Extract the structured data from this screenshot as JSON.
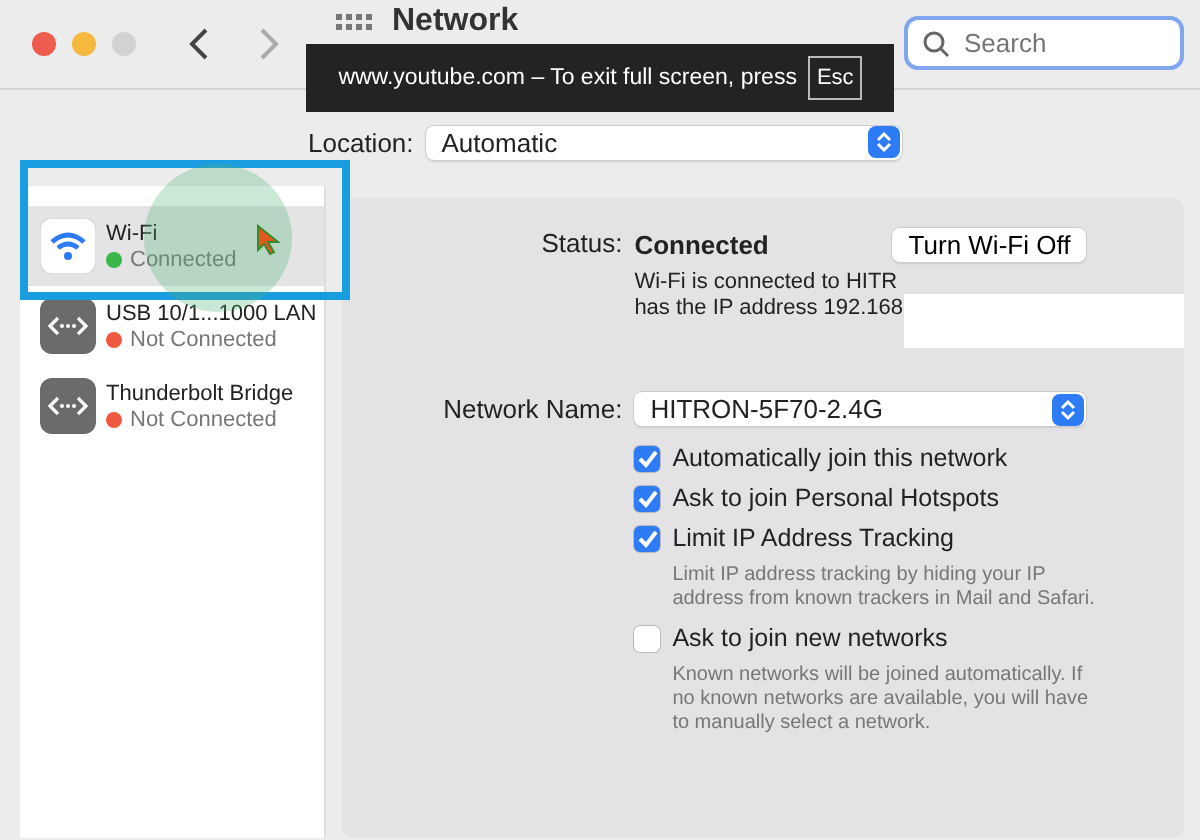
{
  "window": {
    "title": "Network",
    "banner": {
      "text": "www.youtube.com – To exit full screen, press",
      "key": "Esc"
    }
  },
  "search": {
    "placeholder": "Search"
  },
  "location": {
    "label": "Location:",
    "value": "Automatic"
  },
  "sidebar": {
    "items": [
      {
        "name": "Wi-Fi",
        "status": "Connected",
        "color": "#3cb54a",
        "kind": "wifi",
        "selected": true
      },
      {
        "name": "USB 10/1...1000 LAN",
        "status": "Not Connected",
        "color": "#f0583f",
        "kind": "ethernet",
        "selected": false
      },
      {
        "name": "Thunderbolt Bridge",
        "status": "Not Connected",
        "color": "#f0583f",
        "kind": "ethernet",
        "selected": false
      }
    ]
  },
  "status": {
    "label": "Status:",
    "value": "Connected",
    "button": "Turn Wi-Fi Off",
    "description": [
      "Wi-Fi is connected to HITR",
      "has the IP address 192.168"
    ]
  },
  "network_name": {
    "label": "Network Name:",
    "value": "HITRON-5F70-2.4G"
  },
  "options": [
    {
      "label": "Automatically join this network",
      "checked": true
    },
    {
      "label": "Ask to join Personal Hotspots",
      "checked": true
    },
    {
      "label": "Limit IP Address Tracking",
      "checked": true,
      "description": "Limit IP address tracking by hiding your IP address from known trackers in Mail and Safari."
    },
    {
      "label": "Ask to join new networks",
      "checked": false,
      "description": "Known networks will be joined automatically. If no known networks are available, you will have to manually select a network."
    }
  ]
}
